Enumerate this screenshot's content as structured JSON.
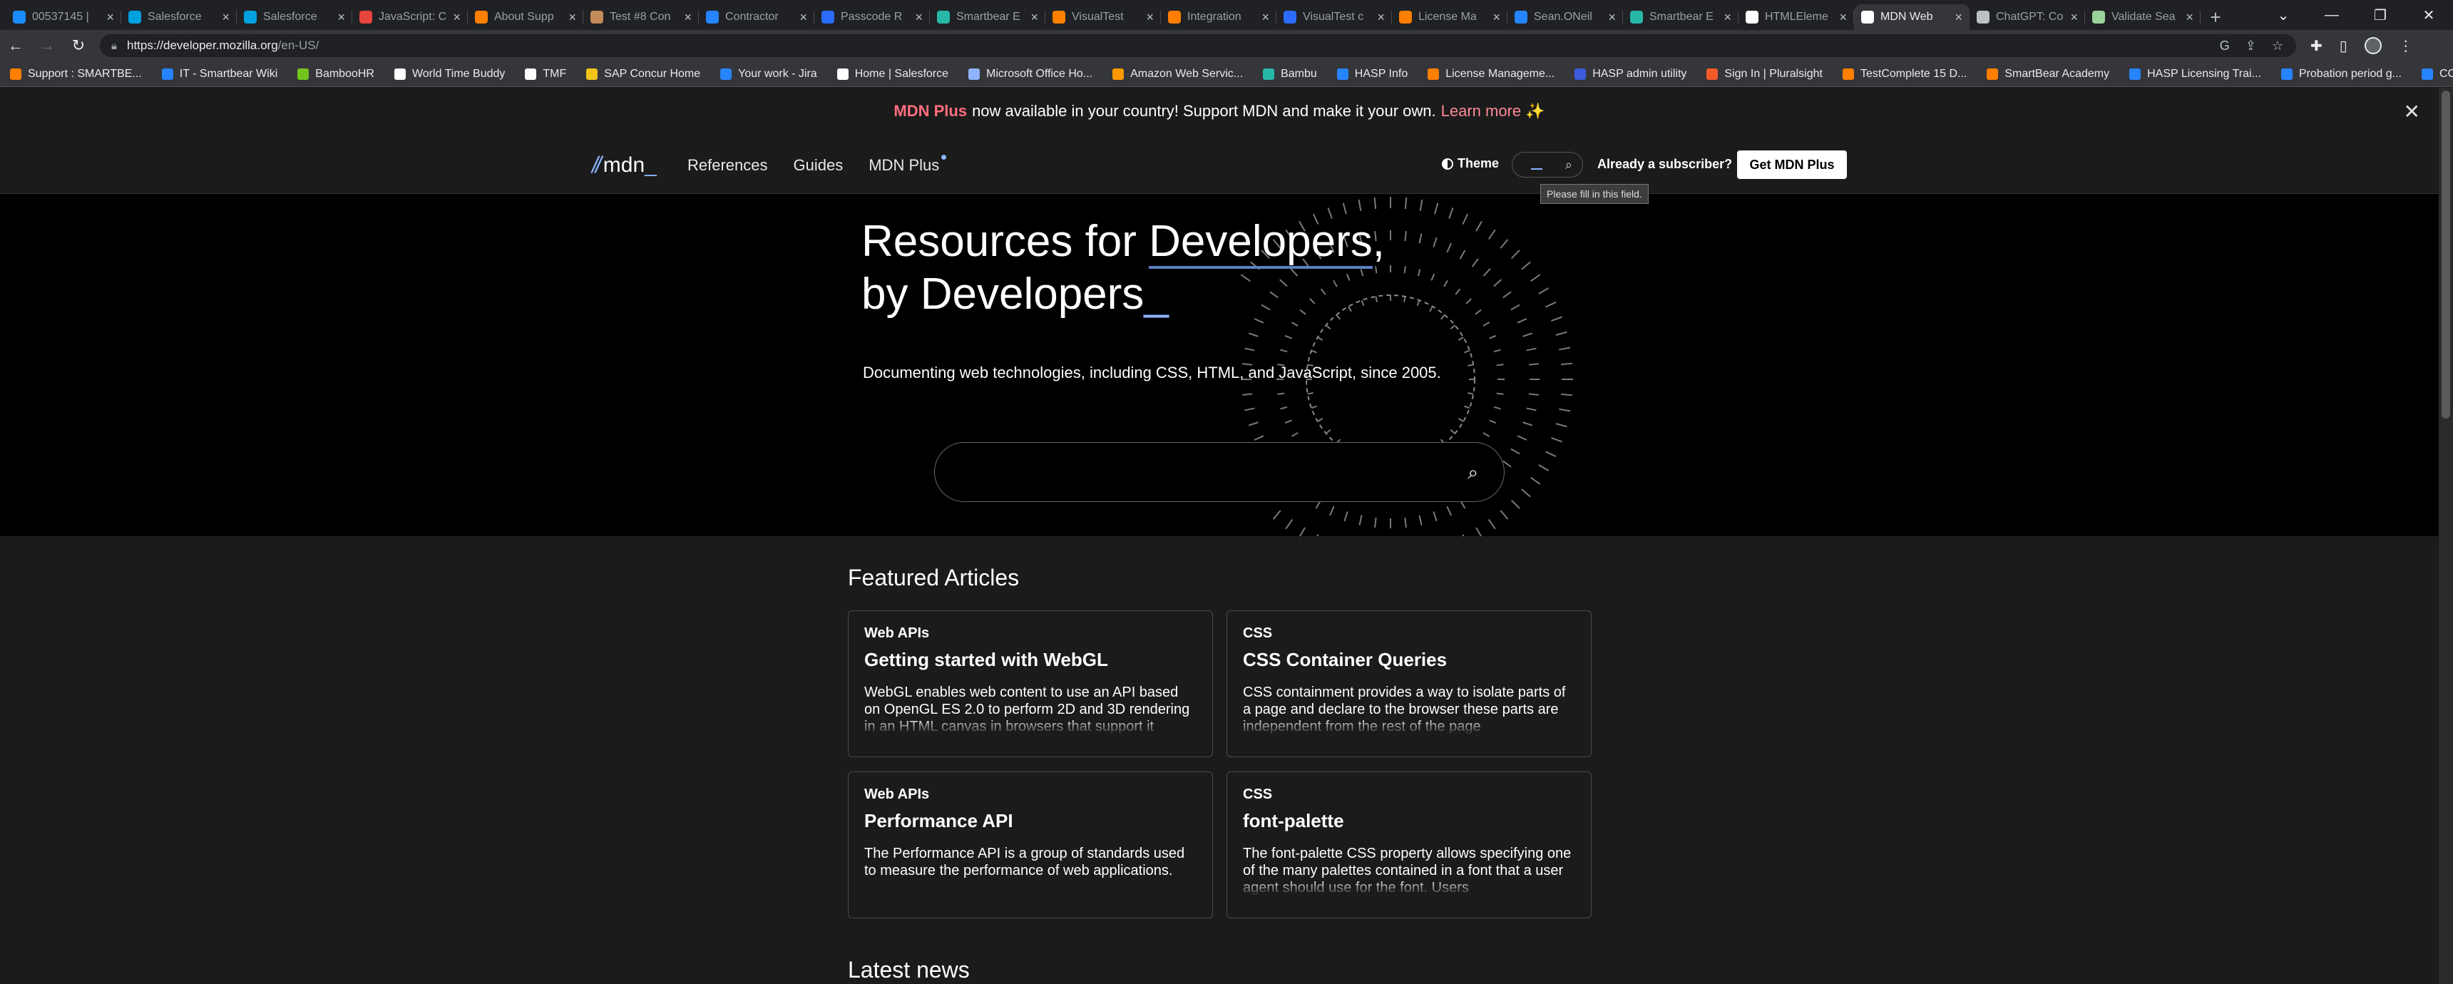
{
  "browser": {
    "tabs": [
      {
        "title": "00537145 |",
        "color": "#1a8cff"
      },
      {
        "title": "Salesforce",
        "color": "#00a1e0"
      },
      {
        "title": "Salesforce",
        "color": "#00a1e0"
      },
      {
        "title": "JavaScript: C",
        "color": "#e8453c"
      },
      {
        "title": "About Supp",
        "color": "#ff7f00"
      },
      {
        "title": "Test #8 Con",
        "color": "#c48b5a"
      },
      {
        "title": "Contractor",
        "color": "#2684ff"
      },
      {
        "title": "Passcode R",
        "color": "#2b6cff"
      },
      {
        "title": "Smartbear E",
        "color": "#27b7a7"
      },
      {
        "title": "VisualTest",
        "color": "#ff7f00"
      },
      {
        "title": "Integration",
        "color": "#ff7f00"
      },
      {
        "title": "VisualTest c",
        "color": "#2b6cff"
      },
      {
        "title": "License Ma",
        "color": "#ff7f00"
      },
      {
        "title": "Sean.ONeil",
        "color": "#2684ff"
      },
      {
        "title": "Smartbear E",
        "color": "#27b7a7"
      },
      {
        "title": "HTMLEleme",
        "color": "#ffffff"
      },
      {
        "title": "MDN Web",
        "color": "#ffffff",
        "active": true
      },
      {
        "title": "ChatGPT: Co",
        "color": "#bdc1c6"
      },
      {
        "title": "Validate Sea",
        "color": "#9ad39a"
      }
    ],
    "new_tab": "+",
    "url_host": "https://developer.mozilla.org",
    "url_path": "/en-US/",
    "bookmarks": [
      {
        "label": "Support : SMARTBE...",
        "color": "#ff7f00"
      },
      {
        "label": "IT - Smartbear Wiki",
        "color": "#2684ff"
      },
      {
        "label": "BambooHR",
        "color": "#73c41d"
      },
      {
        "label": "World Time Buddy",
        "color": "#ffffff"
      },
      {
        "label": "TMF",
        "color": "#ffffff"
      },
      {
        "label": "SAP Concur Home",
        "color": "#f0c419"
      },
      {
        "label": "Your work - Jira",
        "color": "#2684ff"
      },
      {
        "label": "Home | Salesforce",
        "color": "#ffffff"
      },
      {
        "label": "Microsoft Office Ho...",
        "color": "#8fb4ff"
      },
      {
        "label": "Amazon Web Servic...",
        "color": "#ff9900"
      },
      {
        "label": "Bambu",
        "color": "#27b7a7"
      },
      {
        "label": "HASP Info",
        "color": "#2684ff"
      },
      {
        "label": "License Manageme...",
        "color": "#ff7f00"
      },
      {
        "label": "HASP admin utility",
        "color": "#3b5bdb"
      },
      {
        "label": "Sign In | Pluralsight",
        "color": "#f15b2a"
      },
      {
        "label": "TestComplete 15 D...",
        "color": "#ff7f00"
      },
      {
        "label": "SmartBear Academy",
        "color": "#ff7f00"
      },
      {
        "label": "HASP Licensing Trai...",
        "color": "#2684ff"
      },
      {
        "label": "Probation period g...",
        "color": "#2684ff"
      },
      {
        "label": "CCE: Onboarding C...",
        "color": "#2684ff"
      }
    ]
  },
  "banner": {
    "brand": "MDN Plus",
    "text": "now available in your country! Support MDN and make it your own.",
    "link": "Learn more ✨",
    "close": "✕"
  },
  "header": {
    "logo": "mdn",
    "nav": [
      "References",
      "Guides",
      "MDN Plus"
    ],
    "theme": "Theme",
    "search_tooltip": "Please fill in this field.",
    "subscriber": "Already a subscriber?",
    "cta": "Get MDN Plus"
  },
  "hero": {
    "line1_a": "Resources for ",
    "line1_b": "Developers",
    "line1_c": ",",
    "line2": "by Developers",
    "cursor": "_",
    "tagline": "Documenting web technologies, including CSS, HTML, and JavaScript, since 2005.",
    "search_placeholder": ""
  },
  "featured": {
    "heading": "Featured Articles",
    "cards": [
      {
        "category": "Web APIs",
        "title": "Getting started with WebGL",
        "desc": "WebGL enables web content to use an API based on OpenGL ES 2.0 to perform 2D and 3D rendering in an HTML canvas in browsers that support it"
      },
      {
        "category": "CSS",
        "title": "CSS Container Queries",
        "desc": "CSS containment provides a way to isolate parts of a page and declare to the browser these parts are independent from the rest of the page"
      },
      {
        "category": "Web APIs",
        "title": "Performance API",
        "desc": "The Performance API is a group of standards used to measure the performance of web applications."
      },
      {
        "category": "CSS",
        "title": "font-palette",
        "desc": "The font-palette CSS property allows specifying one of the many palettes contained in a font that a user agent should use for the font. Users"
      }
    ]
  },
  "latest_news": "Latest news"
}
